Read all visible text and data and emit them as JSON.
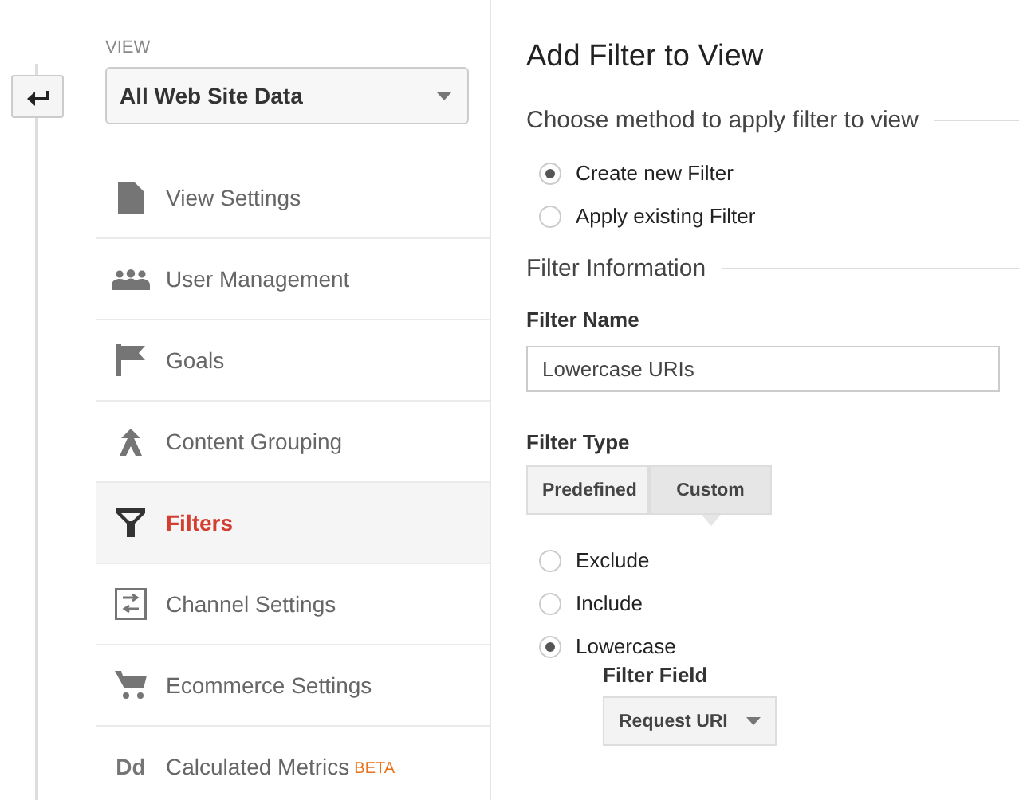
{
  "sidebar": {
    "view_label": "VIEW",
    "view_select": "All Web Site Data",
    "items": [
      {
        "label": "View Settings",
        "selected": false
      },
      {
        "label": "User Management",
        "selected": false
      },
      {
        "label": "Goals",
        "selected": false
      },
      {
        "label": "Content Grouping",
        "selected": false
      },
      {
        "label": "Filters",
        "selected": true
      },
      {
        "label": "Channel Settings",
        "selected": false
      },
      {
        "label": "Ecommerce Settings",
        "selected": false
      },
      {
        "label": "Calculated Metrics",
        "badge": "BETA",
        "icon_text": "Dd",
        "selected": false
      }
    ]
  },
  "panel": {
    "title": "Add Filter to View",
    "method_heading": "Choose method to apply filter to view",
    "methods": [
      {
        "label": "Create new Filter",
        "selected": true
      },
      {
        "label": "Apply existing Filter",
        "selected": false
      }
    ],
    "info_heading": "Filter Information",
    "name_label": "Filter Name",
    "name_value": "Lowercase URIs",
    "type_label": "Filter Type",
    "types": [
      {
        "label": "Predefined",
        "selected": false
      },
      {
        "label": "Custom",
        "selected": true
      }
    ],
    "options": [
      {
        "label": "Exclude",
        "selected": false
      },
      {
        "label": "Include",
        "selected": false
      },
      {
        "label": "Lowercase",
        "selected": true
      }
    ],
    "field_label": "Filter Field",
    "field_value": "Request URI"
  }
}
